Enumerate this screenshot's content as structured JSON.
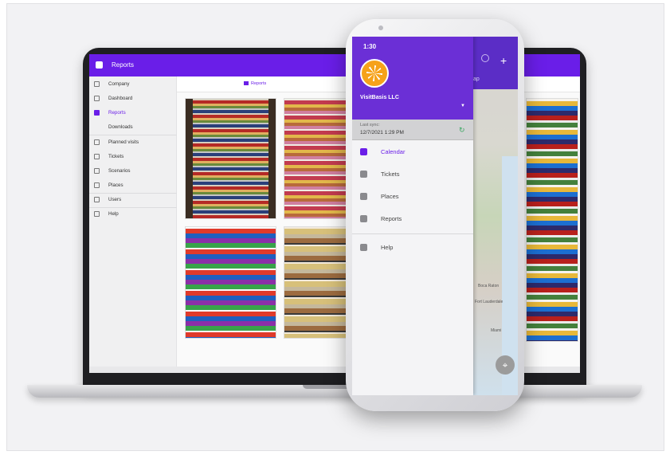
{
  "laptop": {
    "app_title": "Reports",
    "tab_label": "Reports",
    "sidebar": [
      {
        "label": "Company"
      },
      {
        "label": "Dashboard"
      },
      {
        "label": "Reports",
        "active": true
      },
      {
        "label": "Downloads"
      },
      {
        "label": "Planned visits"
      },
      {
        "label": "Tickets"
      },
      {
        "label": "Scenarios"
      },
      {
        "label": "Places"
      },
      {
        "label": "Users"
      },
      {
        "label": "Help"
      }
    ],
    "photos": [
      "shelf-photo",
      "shelf-photo",
      "shelf-photo",
      "shelf-photo",
      "shelf-photo"
    ],
    "action_icons": [
      "help-icon",
      "flag-icon",
      "refresh-icon",
      "more-icon"
    ]
  },
  "phone": {
    "status_time": "1:30",
    "org_name": "VisitBasis LLC",
    "sync_label": "Last sync:",
    "sync_time": "12/7/2021 1:29 PM",
    "menu": [
      {
        "label": "Calendar",
        "icon": "calendar-icon",
        "active": true
      },
      {
        "label": "Tickets",
        "icon": "tickets-icon"
      },
      {
        "label": "Places",
        "icon": "place-icon"
      },
      {
        "label": "Reports",
        "icon": "reports-icon"
      },
      {
        "label": "Help",
        "icon": "help-book-icon"
      }
    ],
    "map_tab": "ap",
    "map_labels": [
      "Boca Raton",
      "Fort Lauderdale",
      "Miami"
    ]
  },
  "colors": {
    "accent": "#6a1ee8",
    "drawer_header": "#6b2fd6",
    "sync_icon": "#3aa660"
  }
}
